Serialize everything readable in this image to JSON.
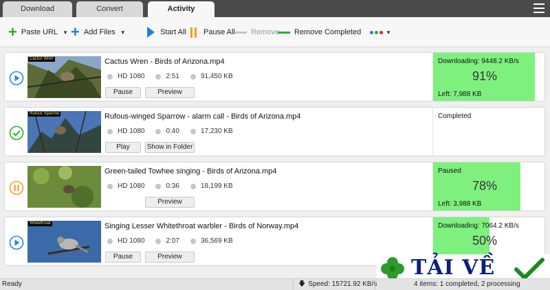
{
  "tabs": [
    {
      "label": "Download",
      "active": false
    },
    {
      "label": "Convert",
      "active": false
    },
    {
      "label": "Activity",
      "active": true
    }
  ],
  "toolbar": {
    "paste_url": "Paste URL",
    "add_files": "Add Files",
    "start_all": "Start All",
    "pause_all": "Pause All",
    "remove": "Remove",
    "remove_completed": "Remove Completed",
    "color_dots": [
      "#1e7fe0",
      "#1db31d",
      "#e02020"
    ]
  },
  "items": [
    {
      "status_icon": "play-icon",
      "status_color": "#1e88e5",
      "file_name": "Cactus Wren - Birds of Arizona.mp4",
      "quality": "HD 1080",
      "duration": "2:51",
      "size": "91,450 KB",
      "buttons": [
        "Pause",
        "Preview"
      ],
      "status_text": "Downloading: 9448.2 KB/s",
      "progress": 91,
      "progress_label": "91%",
      "left_text": "Left: 7,988 KB",
      "thumb_tag": "Cactus Wren"
    },
    {
      "status_icon": "check-circle-icon",
      "status_color": "#1db31d",
      "file_name": "Rufous-winged Sparrow - alarm call - Birds of Arizona.mp4",
      "quality": "HD 1080",
      "duration": "0:40",
      "size": "17,230 KB",
      "buttons": [
        "Play",
        "Show in Folder"
      ],
      "status_text": "Completed",
      "progress": null,
      "progress_label": "",
      "left_text": "",
      "thumb_tag": "Rufous Sparrow"
    },
    {
      "status_icon": "pause-icon",
      "status_color": "#f0a020",
      "file_name": "Green-tailed Towhee singing - Birds of Arizona.mp4",
      "quality": "HD 1080",
      "duration": "0:36",
      "size": "18,199 KB",
      "buttons": [
        "Preview"
      ],
      "status_text": "Paused",
      "progress": 78,
      "progress_label": "78%",
      "left_text": "Left: 3,988 KB",
      "thumb_tag": ""
    },
    {
      "status_icon": "play-icon",
      "status_color": "#1e88e5",
      "file_name": "Singing Lesser Whitethroat warbler - Birds of Norway.mp4",
      "quality": "HD 1080",
      "duration": "2:07",
      "size": "36,569 KB",
      "buttons": [
        "Pause",
        "Preview"
      ],
      "status_text": "Downloading: 7064.2 KB/s",
      "progress": 50,
      "progress_label": "50%",
      "left_text": "",
      "thumb_tag": "Whitethroat"
    }
  ],
  "statusbar": {
    "ready": "Ready",
    "speed": "Speed: 15721.92 KB/s",
    "items": "4 items: 1 completed, 2 processing"
  },
  "watermark": {
    "text": "TẢI VỀ"
  }
}
